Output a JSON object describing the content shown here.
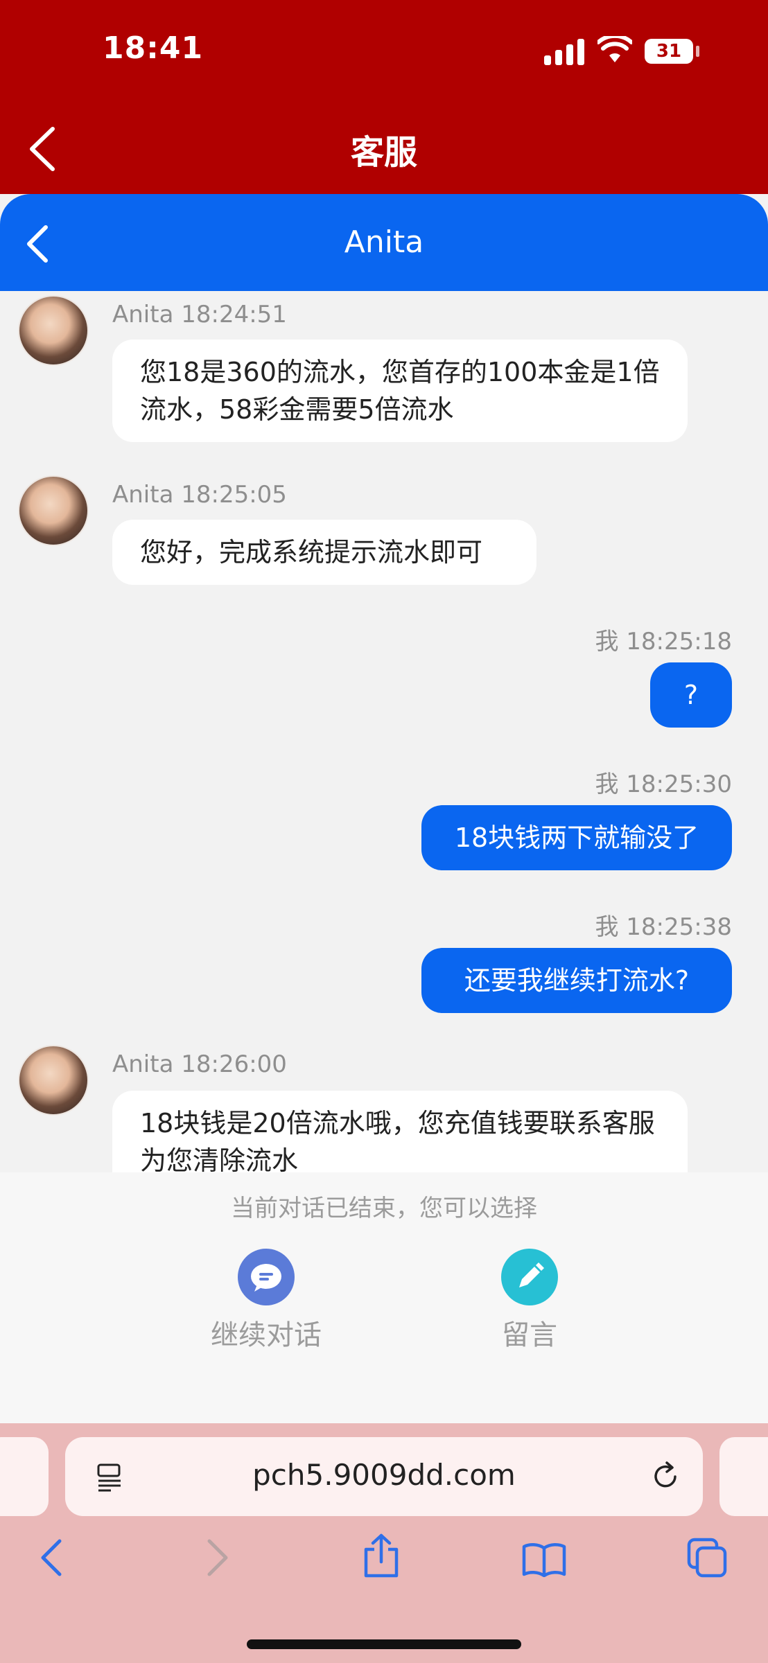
{
  "status_bar": {
    "time": "18:41",
    "battery": "31"
  },
  "header": {
    "title": "客服"
  },
  "chat_header": {
    "title": "Anita"
  },
  "messages": [
    {
      "sender": "Anita",
      "time": "18:24:51",
      "meta": "Anita 18:24:51",
      "text": "您18是360的流水，您首存的100本金是1倍流水，58彩金需要5倍流水"
    },
    {
      "sender": "Anita",
      "time": "18:25:05",
      "meta": "Anita 18:25:05",
      "text": "您好，完成系统提示流水即可"
    },
    {
      "sender": "我",
      "time": "18:25:18",
      "meta": "我 18:25:18",
      "text": "?"
    },
    {
      "sender": "我",
      "time": "18:25:30",
      "meta": "我 18:25:30",
      "text": "18块钱两下就输没了"
    },
    {
      "sender": "我",
      "time": "18:25:38",
      "meta": "我 18:25:38",
      "text": "还要我继续打流水?"
    },
    {
      "sender": "Anita",
      "time": "18:26:00",
      "meta": "Anita 18:26:00",
      "text": "18块钱是20倍流水哦，您充值钱要联系客服为您清除流水"
    }
  ],
  "conversation_ended": {
    "notice": "当前对话已结束，您可以选择",
    "continue_label": "继续对话",
    "message_label": "留言"
  },
  "browser": {
    "url": "pch5.9009dd.com"
  },
  "colors": {
    "red": "#b00000",
    "blue": "#0a66f0",
    "teal": "#27c0d4",
    "browser_pink": "#eab8b8"
  }
}
